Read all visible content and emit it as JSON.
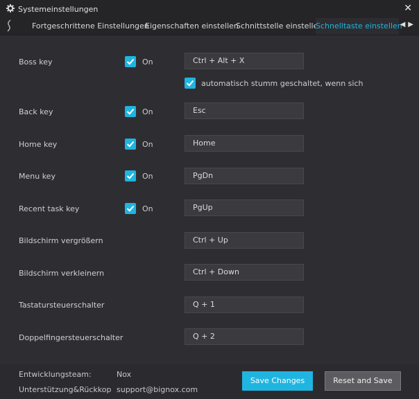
{
  "window": {
    "title": "Systemeinstellungen",
    "close": "✕"
  },
  "tabs": [
    {
      "label": "Fortgeschrittene Einstellungen"
    },
    {
      "label": "Eigenschaften einstellen"
    },
    {
      "label": "Schnittstelle einstellen"
    },
    {
      "label": "Schnelltaste einstellen",
      "active": true
    }
  ],
  "on_label": "On",
  "rows": {
    "boss": {
      "label": "Boss key",
      "value": "Ctrl + Alt + X",
      "checked": true
    },
    "mute": {
      "label": "automatisch stumm geschaltet, wenn sich versteckt",
      "checked": true
    },
    "back": {
      "label": "Back key",
      "value": "Esc",
      "checked": true
    },
    "home": {
      "label": "Home key",
      "value": "Home",
      "checked": true
    },
    "menu": {
      "label": "Menu key",
      "value": "PgDn",
      "checked": true
    },
    "recent": {
      "label": "Recent task key",
      "value": "PgUp",
      "checked": true
    },
    "zoom_in": {
      "label": "Bildschirm vergrößern",
      "value": "Ctrl + Up"
    },
    "zoom_out": {
      "label": "Bildschirm verkleinern",
      "value": "Ctrl + Down"
    },
    "keyboard": {
      "label": "Tastatursteuerschalter",
      "value": "Q + 1"
    },
    "twofinger": {
      "label": "Doppelfingersteuerschalter",
      "value": "Q + 2"
    }
  },
  "footer": {
    "team_label": "Entwicklungsteam:",
    "team_value": "Nox",
    "support_label": "Unterstützung&Rückkopplung:",
    "support_value": "support@bignox.com",
    "save_label": "Save Changes",
    "reset_label": "Reset and Save"
  },
  "colors": {
    "accent": "#1fb5e0",
    "background": "#2e2e32",
    "field": "#3a3a3f"
  },
  "icons": {
    "title": "gear-icon",
    "back": "back-arrow-icon",
    "close": "close-icon",
    "check": "check-icon"
  }
}
